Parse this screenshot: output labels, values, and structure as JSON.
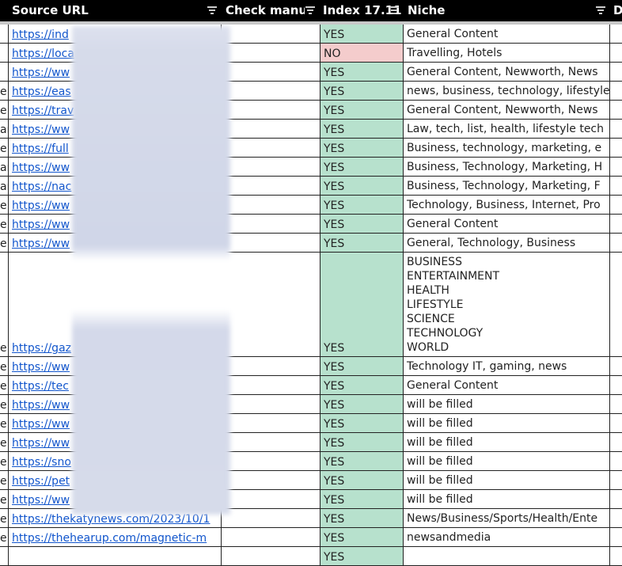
{
  "columns": {
    "source_url": "Source URL",
    "check_manual": "Check manu",
    "index": "Index 17.11",
    "niche": "Niche",
    "next": "D"
  },
  "rows": [
    {
      "a": "",
      "url": "https://ind",
      "index": "YES",
      "niche": "General Content"
    },
    {
      "a": "",
      "url": "https://loca",
      "index": "NO",
      "niche": "Travelling, Hotels",
      "neg": true
    },
    {
      "a": "",
      "url": "https://ww",
      "index": "YES",
      "niche": "General Content, Newworth, News"
    },
    {
      "a": "e",
      "url": "https://eas",
      "index": "YES",
      "niche": "news, business, technology, lifestyle"
    },
    {
      "a": "e",
      "url": "https://trav",
      "index": "YES",
      "niche": "General Content, Newworth, News"
    },
    {
      "a": "ar",
      "url": "https://ww",
      "index": "YES",
      "niche": "Law, tech, list, health, lifestyle tech"
    },
    {
      "a": "e",
      "url": "https://full",
      "index": "YES",
      "niche": "Business, technology, marketing, e"
    },
    {
      "a": "ar",
      "url": "https://ww",
      "index": "YES",
      "niche": "Business, Technology, Marketing, H"
    },
    {
      "a": "ar",
      "url": "https://nac",
      "index": "YES",
      "niche": "Business, Technology, Marketing, F"
    },
    {
      "a": "e",
      "url": "https://ww",
      "index": "YES",
      "niche": "Technology, Business, Internet, Pro"
    },
    {
      "a": "e",
      "url": "https://ww",
      "index": "YES",
      "niche": "General Content"
    },
    {
      "a": "e",
      "url": "https://ww",
      "index": "YES",
      "niche": "General, Technology, Business"
    },
    {
      "a": "e",
      "url": "https://gaz",
      "index": "YES",
      "niche": "BUSINESS\nENTERTAINMENT\nHEALTH\nLIFESTYLE\nSCIENCE\nTECHNOLOGY\nWORLD",
      "tall": true
    },
    {
      "a": "e",
      "url": "https://ww",
      "index": "YES",
      "niche": "Technology IT, gaming, news"
    },
    {
      "a": "e",
      "url": "https://tec",
      "index": "YES",
      "niche": "General Content"
    },
    {
      "a": "e",
      "url": "https://ww",
      "index": "YES",
      "niche": "will be filled"
    },
    {
      "a": "e",
      "url": "https://ww",
      "index": "YES",
      "niche": "will be filled"
    },
    {
      "a": "e",
      "url": "https://ww",
      "index": "YES",
      "niche": "will be filled"
    },
    {
      "a": "e",
      "url": "https://sno",
      "index": "YES",
      "niche": "will be filled"
    },
    {
      "a": "e",
      "url": "https://pet",
      "index": "YES",
      "niche": "will be filled"
    },
    {
      "a": "e",
      "url": "https://ww",
      "index": "YES",
      "niche": "will be filled"
    },
    {
      "a": "e",
      "url": "https://thekatynews.com/2023/10/1",
      "index": "YES",
      "niche": "News/Business/Sports/Health/Ente"
    },
    {
      "a": "e",
      "url": "https://thehearup.com/magnetic-m",
      "index": "YES",
      "niche": "newsandmedia"
    },
    {
      "a": "",
      "url": "",
      "index": "YES",
      "niche": ""
    }
  ]
}
